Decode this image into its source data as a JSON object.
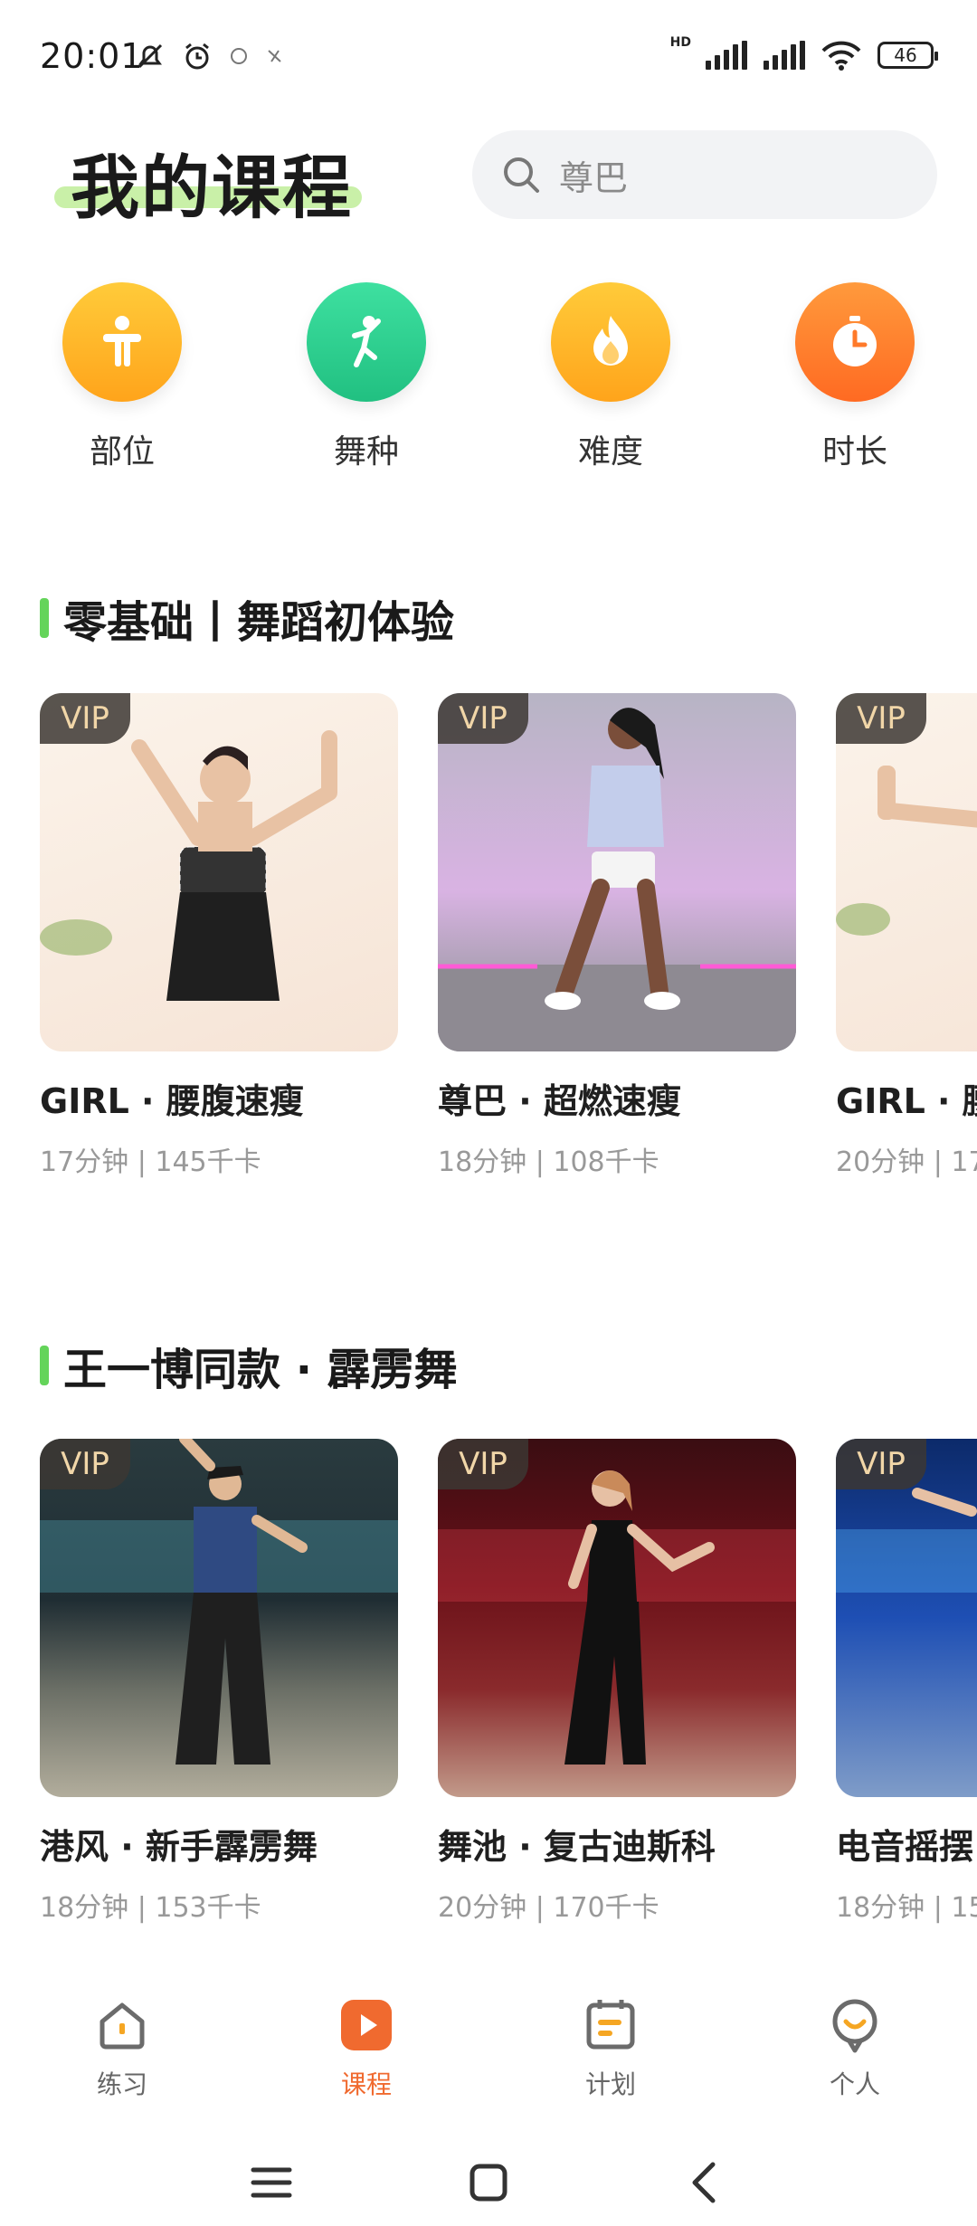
{
  "status": {
    "time": "20:01",
    "hd": "HD",
    "battery": "46",
    "icons": [
      "mute-icon",
      "alarm-icon",
      "app-icon",
      "app-icon",
      "signal-icon",
      "wifi-icon",
      "battery-icon"
    ]
  },
  "header": {
    "title": "我的课程",
    "search_placeholder": "尊巴"
  },
  "categories": [
    {
      "label": "部位",
      "icon": "body-icon",
      "color": "#ffb21c"
    },
    {
      "label": "舞种",
      "icon": "dancer-icon",
      "color": "#2ecf8f"
    },
    {
      "label": "难度",
      "icon": "flame-icon",
      "color": "#ffb21c"
    },
    {
      "label": "时长",
      "icon": "stopwatch-icon",
      "color": "#ff7a2a"
    }
  ],
  "sections": [
    {
      "title": "零基础丨舞蹈初体验",
      "cards": [
        {
          "badge": "VIP",
          "title": "GIRL · 腰腹速瘦",
          "meta": "17分钟 | 145千卡"
        },
        {
          "badge": "VIP",
          "title": "尊巴 · 超燃速瘦",
          "meta": "18分钟 | 108千卡"
        },
        {
          "badge": "VIP",
          "title": "GIRL · 腰",
          "meta": "20分钟 | 17"
        }
      ]
    },
    {
      "title": "王一博同款 · 霹雳舞",
      "cards": [
        {
          "badge": "VIP",
          "title": "港风 · 新手霹雳舞",
          "meta": "18分钟 | 153千卡"
        },
        {
          "badge": "VIP",
          "title": "舞池 · 复古迪斯科",
          "meta": "20分钟 | 170千卡"
        },
        {
          "badge": "VIP",
          "title": "电音摇摆",
          "meta": "18分钟 | 15"
        }
      ]
    }
  ],
  "bottom_nav": [
    {
      "label": "练习",
      "icon": "home-icon",
      "active": false
    },
    {
      "label": "课程",
      "icon": "play-icon",
      "active": true
    },
    {
      "label": "计划",
      "icon": "calendar-icon",
      "active": false
    },
    {
      "label": "个人",
      "icon": "profile-icon",
      "active": false
    }
  ],
  "colors": {
    "accent": "#f06a2f",
    "section_bar": "#64d45a",
    "title_highlight": "#c9f0a8",
    "vip_text": "#f1d6a8"
  }
}
